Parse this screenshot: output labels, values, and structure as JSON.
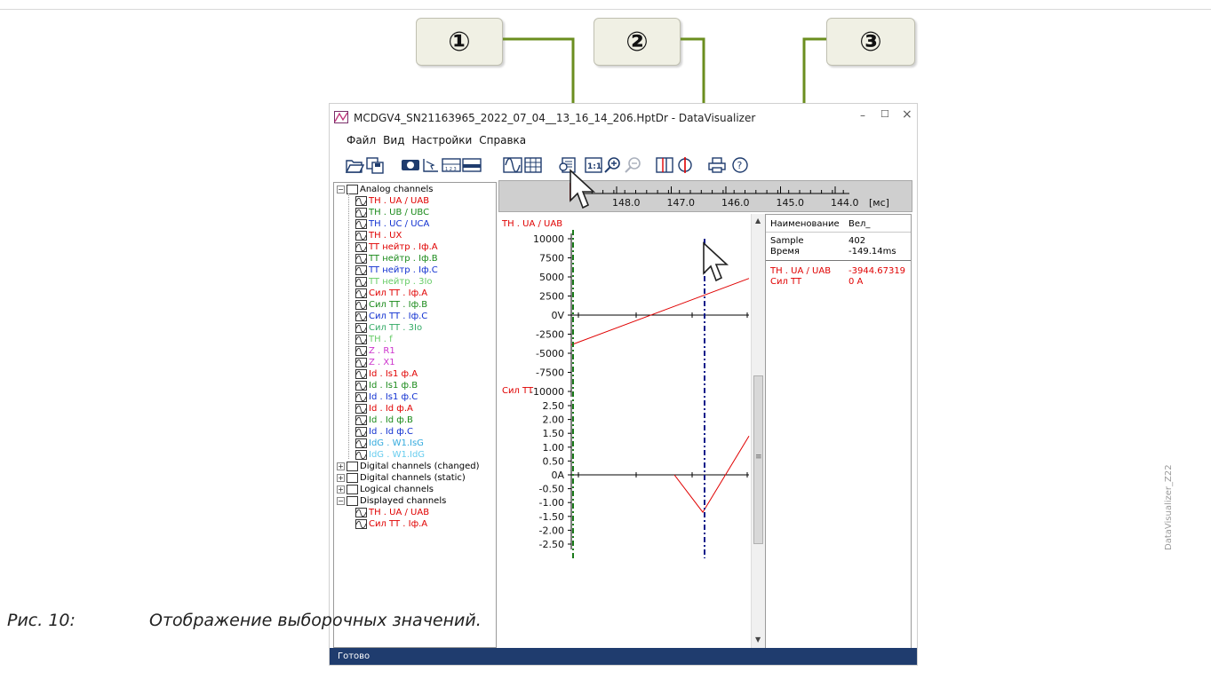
{
  "callouts": [
    "①",
    "②",
    "③"
  ],
  "window": {
    "title": "MCDGV4_SN21163965_2022_07_04__13_16_14_206.HptDr - DataVisualizer",
    "controls": [
      "–",
      "☐",
      "×"
    ],
    "menu": [
      "Файл",
      "Вид",
      "Настройки",
      "Справка"
    ],
    "status": "Готово"
  },
  "toolbar_icons": [
    "open-icon",
    "save-icon",
    "cursor-icon",
    "select-icon",
    "ruler-icon",
    "layout-icon",
    "wave-icon",
    "grid-icon",
    "sample-values-icon",
    "scale-1to1-icon",
    "zoom-in-icon",
    "zoom-out-icon",
    "cursor-sync-icon",
    "phasor-icon",
    "print-icon",
    "help-icon"
  ],
  "toolbar_scale_label": "1:1",
  "toolbar_help_label": "?",
  "tree": {
    "groups": [
      {
        "label": "Analog channels",
        "expanded": true,
        "items": [
          {
            "label": "TH . UA  / UAB",
            "color": "#e00000"
          },
          {
            "label": "TH . UB  / UBC",
            "color": "#1a8a1a"
          },
          {
            "label": "TH . UC  / UCA",
            "color": "#1030d0"
          },
          {
            "label": "TH . UX",
            "color": "#e00000"
          },
          {
            "label": "TT нейтр . Iф.A",
            "color": "#e00000"
          },
          {
            "label": "TT нейтр . Iф.B",
            "color": "#1a8a1a"
          },
          {
            "label": "TT нейтр . Iф.C",
            "color": "#1030d0"
          },
          {
            "label": "TT нейтр . 3Io",
            "color": "#66cc66"
          },
          {
            "label": "Сил TT . Iф.A",
            "color": "#e00000"
          },
          {
            "label": "Сил TT . Iф.B",
            "color": "#1a8a1a"
          },
          {
            "label": "Сил TT . Iф.C",
            "color": "#1030d0"
          },
          {
            "label": "Сил TT . 3Io",
            "color": "#33aa66"
          },
          {
            "label": "TH . f",
            "color": "#66cc66"
          },
          {
            "label": "Z . R1",
            "color": "#cc33cc"
          },
          {
            "label": "Z . X1",
            "color": "#cc33cc"
          },
          {
            "label": "Id . Is1 ф.A",
            "color": "#e00000"
          },
          {
            "label": "Id . Is1 ф.B",
            "color": "#1a8a1a"
          },
          {
            "label": "Id . Is1 ф.C",
            "color": "#1030d0"
          },
          {
            "label": "Id . Id ф.A",
            "color": "#e00000"
          },
          {
            "label": "Id . Id ф.B",
            "color": "#1a8a1a"
          },
          {
            "label": "Id . Id ф.C",
            "color": "#1030d0"
          },
          {
            "label": "IdG . W1.IsG",
            "color": "#33aadd"
          },
          {
            "label": "IdG . W1.IdG",
            "color": "#66ccee"
          }
        ]
      },
      {
        "label": "Digital channels (changed)",
        "expanded": false,
        "items": []
      },
      {
        "label": "Digital channels (static)",
        "expanded": false,
        "items": []
      },
      {
        "label": "Logical channels",
        "expanded": false,
        "items": []
      },
      {
        "label": "Displayed channels",
        "expanded": true,
        "items": [
          {
            "label": "TH . UA  / UAB",
            "color": "#e00000"
          },
          {
            "label": "Сил TT . Iф.A",
            "color": "#e00000"
          }
        ]
      }
    ]
  },
  "time_axis": {
    "ticks": [
      "148.0",
      "147.0",
      "146.0",
      "145.0",
      "144.0"
    ],
    "unit": "[мс]"
  },
  "chart_data": [
    {
      "type": "line",
      "title": "TH . UA  / UAB",
      "yticks": [
        "10000",
        "7500",
        "5000",
        "2500",
        "0V",
        "-2500",
        "-5000",
        "-7500",
        "-10000"
      ],
      "ylim": [
        -10000,
        10000
      ],
      "series": [
        {
          "name": "TH . UA  / UAB",
          "color": "#e00000",
          "x": [
            0.0,
            1.0
          ],
          "y": [
            -3900,
            4800
          ]
        }
      ]
    },
    {
      "type": "line",
      "title": "Сил TT",
      "yticks": [
        "2.50",
        "2.00",
        "1.50",
        "1.00",
        "0.50",
        "0A",
        "-0.50",
        "-1.00",
        "-1.50",
        "-2.00",
        "-2.50"
      ],
      "ylim": [
        -2.5,
        2.5
      ],
      "series": [
        {
          "name": "Сил TT",
          "color": "#e00000",
          "x": [
            0.58,
            0.74,
            1.0
          ],
          "y": [
            0.0,
            -1.35,
            1.4
          ]
        }
      ]
    }
  ],
  "info_panel": {
    "header": [
      "Наименование",
      "Вел_"
    ],
    "rows": [
      {
        "name": "Sample",
        "value": "402"
      },
      {
        "name": "Время",
        "value": "-149.14ms"
      }
    ],
    "channels": [
      {
        "name": "TH . UA  / UAB",
        "value": "-3944.67319"
      },
      {
        "name": "Сил TT",
        "value": "0 A"
      }
    ],
    "color": "#e00000"
  },
  "caption": {
    "label": "Рис. 10:",
    "text": "Отображение выборочных значений."
  },
  "side_label": "DataVisualizer_Z22",
  "colors": {
    "accent": "#6b8e1f",
    "status_bar": "#1f3c6e",
    "cursor_green": "#1a7a1a",
    "cursor_blue": "#0a1a8a"
  }
}
